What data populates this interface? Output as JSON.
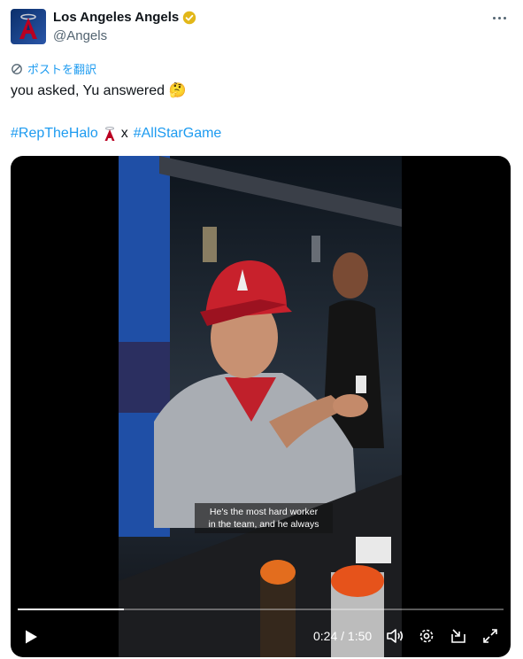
{
  "account": {
    "display_name": "Los Angeles Angels",
    "handle": "@Angels"
  },
  "translate_label": "ポストを翻訳",
  "tweet": {
    "text": "you asked, Yu answered",
    "text_emoji": "🤔",
    "hashtag_1": "#RepTheHalo",
    "separator": "x",
    "hashtag_2": "#AllStarGame"
  },
  "video": {
    "caption_line1": "He's the most hard worker",
    "caption_line2": "in the team, and he always",
    "current_time": "0:24",
    "duration": "1:50",
    "time_display": "0:24 / 1:50",
    "progress": 0.218
  },
  "colors": {
    "accent": "#1d9bf0",
    "verified_gold": "#e2b719",
    "angels_red": "#ba0021",
    "angels_navy": "#003263"
  },
  "icons": [
    "verified-badge-icon",
    "more-options-icon",
    "translate-icon",
    "thinking-face-emoji",
    "angels-halo-icon",
    "play-icon",
    "volume-icon",
    "settings-icon",
    "minimize-icon",
    "fullscreen-icon"
  ]
}
